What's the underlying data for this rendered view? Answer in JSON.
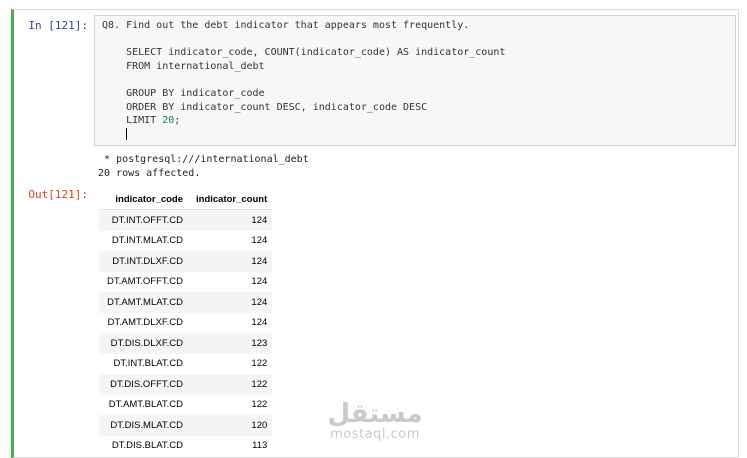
{
  "cell": {
    "in_prompt": "In [121]:",
    "out_prompt": "Out[121]:",
    "code": {
      "line1": "Q8. Find out the debt indicator that appears most frequently.",
      "line2": "",
      "line3": "    SELECT indicator_code, COUNT(indicator_code) AS indicator_count",
      "line4": "    FROM international_debt",
      "line5": "",
      "line6": "    GROUP BY indicator_code",
      "line7": "    ORDER BY indicator_count DESC, indicator_code DESC",
      "line8_prefix": "    LIMIT ",
      "line8_number": "20",
      "line8_suffix": ";"
    },
    "stdout": {
      "line1": " * postgresql:///international_debt",
      "line2": "20 rows affected."
    },
    "table": {
      "headers": [
        "indicator_code",
        "indicator_count"
      ],
      "rows": [
        [
          "DT.INT.OFFT.CD",
          "124"
        ],
        [
          "DT.INT.MLAT.CD",
          "124"
        ],
        [
          "DT.INT.DLXF.CD",
          "124"
        ],
        [
          "DT.AMT.OFFT.CD",
          "124"
        ],
        [
          "DT.AMT.MLAT.CD",
          "124"
        ],
        [
          "DT.AMT.DLXF.CD",
          "124"
        ],
        [
          "DT.DIS.DLXF.CD",
          "123"
        ],
        [
          "DT.INT.BLAT.CD",
          "122"
        ],
        [
          "DT.DIS.OFFT.CD",
          "122"
        ],
        [
          "DT.AMT.BLAT.CD",
          "122"
        ],
        [
          "DT.DIS.MLAT.CD",
          "120"
        ],
        [
          "DT.DIS.BLAT.CD",
          "113"
        ]
      ]
    }
  },
  "watermark": {
    "arabic": "مستقل",
    "latin": "mostaql.com"
  },
  "colors": {
    "active_cell_border": "#4cae4c",
    "in_prompt": "#303f9f",
    "out_prompt": "#d84315"
  }
}
